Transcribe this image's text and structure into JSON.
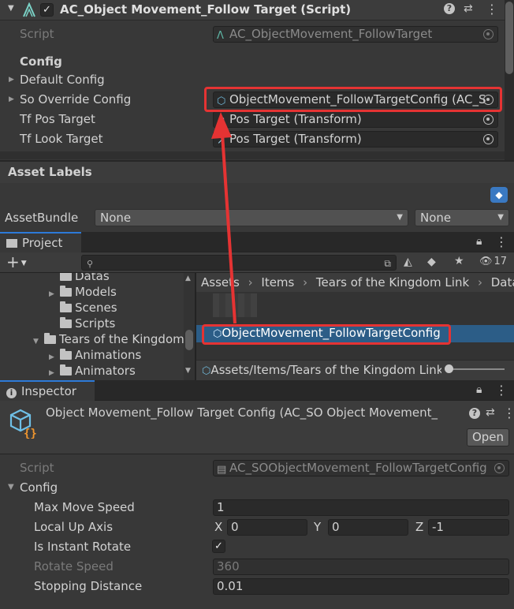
{
  "script_component": {
    "title": "AC_Object Movement_Follow Target (Script)",
    "script_label": "Script",
    "script_value": "AC_ObjectMovement_FollowTarget",
    "section_config": "Config",
    "default_config": "Default Config",
    "so_override_label": "So Override Config",
    "so_override_value": "ObjectMovement_FollowTargetConfig (AC_S",
    "tf_pos_label": "Tf Pos Target",
    "tf_pos_value": "Pos Target (Transform)",
    "tf_look_label": "Tf Look Target",
    "tf_look_value": "Pos Target (Transform)"
  },
  "asset_labels": {
    "title": "Asset Labels",
    "assetbundle_label": "AssetBundle",
    "bundle_value": "None",
    "variant_value": "None"
  },
  "project": {
    "tab_label": "Project",
    "add_label": "+",
    "search_placeholder": "",
    "hidden_count": "17",
    "tree": [
      {
        "label": "Datas",
        "has_caret": false
      },
      {
        "label": "Models",
        "has_caret": true
      },
      {
        "label": "Scenes",
        "has_caret": false
      },
      {
        "label": "Scripts",
        "has_caret": false
      },
      {
        "label": "Tears of the Kingdom",
        "has_caret": true
      },
      {
        "label": "Animations",
        "has_caret": true
      },
      {
        "label": "Animators",
        "has_caret": true
      }
    ],
    "breadcrumb": [
      "Assets",
      "Items",
      "Tears of the Kingdom Link",
      "Datas"
    ],
    "selected_asset": "ObjectMovement_FollowTargetConfig",
    "status_path": "Assets/Items/Tears of the Kingdom Link/"
  },
  "inspector": {
    "tab_label": "Inspector",
    "title": "Object Movement_Follow Target Config (AC_SO Object Movement_",
    "open_button": "Open",
    "script_label": "Script",
    "script_value": "AC_SOObjectMovement_FollowTargetConfig",
    "section_config": "Config",
    "max_move_speed_label": "Max Move Speed",
    "max_move_speed_value": "1",
    "local_up_axis_label": "Local Up Axis",
    "axis_x_label": "X",
    "axis_x_value": "0",
    "axis_y_label": "Y",
    "axis_y_value": "0",
    "axis_z_label": "Z",
    "axis_z_value": "-1",
    "is_instant_rotate_label": "Is Instant Rotate",
    "is_instant_rotate_checked": true,
    "rotate_speed_label": "Rotate Speed",
    "rotate_speed_value": "360",
    "stopping_distance_label": "Stopping Distance",
    "stopping_distance_value": "0.01"
  },
  "colors": {
    "annotation_red": "#e53333",
    "selection_blue": "#2c5d87",
    "tab_accent": "#2d7ad8"
  }
}
